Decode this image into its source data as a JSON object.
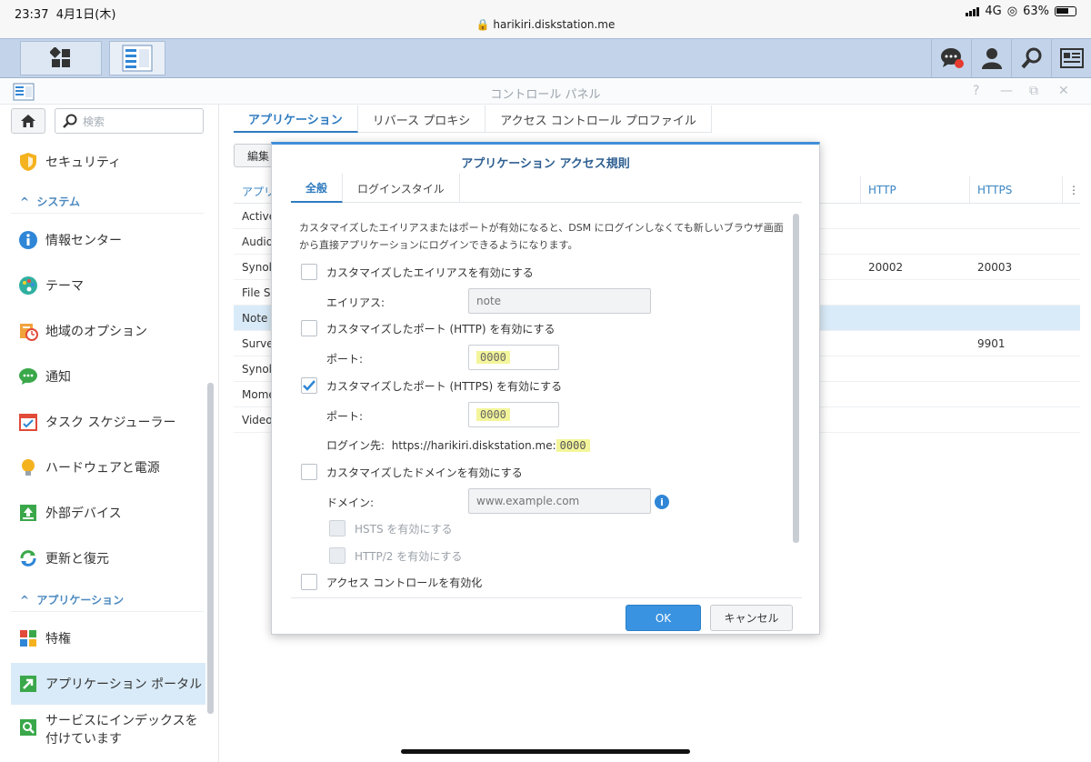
{
  "status_bar": {
    "time": "23:37",
    "date": "4月1日(木)",
    "url": "harikiri.diskstation.me",
    "network": "4G",
    "battery": "63%"
  },
  "window": {
    "title": "コントロール パネル",
    "controls": [
      "?",
      "—",
      "⧉",
      "✕"
    ]
  },
  "sidebar": {
    "search_placeholder": "検索",
    "items": [
      {
        "label": "セキュリティ",
        "icon": "shield-icon"
      },
      {
        "label": "情報センター",
        "icon": "info-icon"
      },
      {
        "label": "テーマ",
        "icon": "palette-icon"
      },
      {
        "label": "地域のオプション",
        "icon": "clock-icon"
      },
      {
        "label": "通知",
        "icon": "chat-icon"
      },
      {
        "label": "タスク スケジューラー",
        "icon": "calendar-icon"
      },
      {
        "label": "ハードウェアと電源",
        "icon": "bulb-icon"
      },
      {
        "label": "外部デバイス",
        "icon": "upload-icon"
      },
      {
        "label": "更新と復元",
        "icon": "refresh-icon"
      },
      {
        "label": "特権",
        "icon": "tiles-icon"
      },
      {
        "label": "アプリケーション ポータル",
        "icon": "portal-icon"
      },
      {
        "label_line1": "サービスにインデックスを",
        "label_line2": "付けています",
        "icon": "index-icon"
      }
    ],
    "sections": {
      "system": "システム",
      "application": "アプリケーション"
    }
  },
  "main": {
    "tabs": [
      "アプリケーション",
      "リバース プロキシ",
      "アクセス コントロール プロファイル"
    ],
    "edit_button": "編集",
    "columns": {
      "name": "アプリ",
      "http": "HTTP",
      "https": "HTTPS"
    },
    "rows": [
      {
        "name": "Active",
        "http": "",
        "https": ""
      },
      {
        "name": "Audio",
        "http": "",
        "https": ""
      },
      {
        "name": "Synol",
        "http": "20002",
        "https": "20003"
      },
      {
        "name": "File S",
        "http": "",
        "https": ""
      },
      {
        "name": "Note",
        "http": "",
        "https": ""
      },
      {
        "name": "Surve",
        "http": "",
        "https": "9901"
      },
      {
        "name": "Synol",
        "http": "",
        "https": ""
      },
      {
        "name": "Mome",
        "http": "",
        "https": ""
      },
      {
        "name": "Video",
        "http": "",
        "https": ""
      }
    ]
  },
  "dialog": {
    "title": "アプリケーション アクセス規則",
    "tabs": [
      "全般",
      "ログインスタイル"
    ],
    "description": "カスタマイズしたエイリアスまたはポートが有効になると、DSM にログインしなくても新しいブラウザ画面から直接アプリケーションにログインできるようになります。",
    "alias_checkbox": "カスタマイズしたエイリアスを有効にする",
    "alias_label": "エイリアス:",
    "alias_placeholder": "note",
    "http_checkbox": "カスタマイズしたポート (HTTP) を有効にする",
    "http_port_label": "ポート:",
    "http_port_value": "0000",
    "https_checkbox": "カスタマイズしたポート (HTTPS) を有効にする",
    "https_port_label": "ポート:",
    "https_port_value": "0000",
    "login_label": "ログイン先:",
    "login_url": "https://harikiri.diskstation.me:",
    "login_port": "0000",
    "domain_checkbox": "カスタマイズしたドメインを有効にする",
    "domain_label": "ドメイン:",
    "domain_placeholder": "www.example.com",
    "hsts_checkbox": "HSTS を有効にする",
    "http2_checkbox": "HTTP/2 を有効にする",
    "access_control_checkbox": "アクセス コントロールを有効化",
    "ok": "OK",
    "cancel": "キャンセル"
  }
}
